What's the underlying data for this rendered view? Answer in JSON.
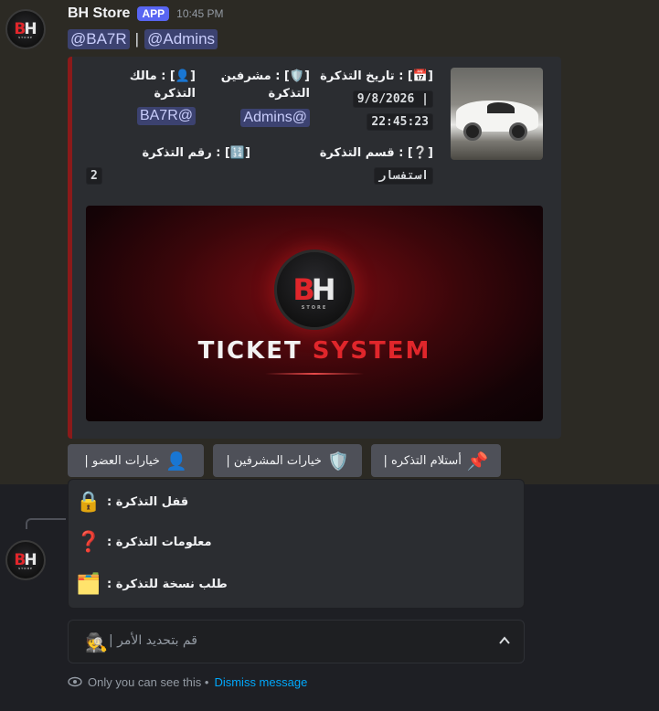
{
  "message": {
    "bot_name": "BH Store",
    "app_badge": "APP",
    "time": "10:45 PM",
    "mention_user": "@BA7R",
    "separator": "|",
    "mention_role": "@Admins"
  },
  "avatar": {
    "letter_b": "B",
    "letter_h": "H",
    "sub": "STORE"
  },
  "embed": {
    "accent_color": "#8b1a1a",
    "fields": {
      "date": {
        "name": "[📅] : تاريخ التذكرة",
        "value_line1": "9/8/2026 |",
        "value_line2": "22:45:23"
      },
      "supervisors": {
        "name": "[🛡️] : مشرفين التذكرة",
        "value": "@Admins"
      },
      "owner": {
        "name": "[👤] : مالك التذكرة",
        "value": "@BA7R"
      },
      "category": {
        "name": "[❔] : قسم التذكرة",
        "value": "استفسار"
      },
      "number": {
        "name": "[🔢] : رقم التذكرة",
        "value": "2"
      }
    },
    "image": {
      "title_part1": "TICKET",
      "title_part2": "SYSTEM",
      "logo_b": "B",
      "logo_h": "H",
      "logo_sub": "STORE"
    }
  },
  "buttons": [
    {
      "label": "أستلام التذكره |",
      "icon": "📌"
    },
    {
      "label": "خيارات المشرفين |",
      "icon": "🛡️"
    },
    {
      "label": "خيارات العضو |",
      "icon": "👤"
    }
  ],
  "dropdown": {
    "items": [
      {
        "label": "قفل التذكرة :",
        "icon": "🔒"
      },
      {
        "label": "معلومات التذكرة :",
        "icon": "❓"
      },
      {
        "label": "طلب نسخة للتذكرة :",
        "icon": "🗂️"
      }
    ]
  },
  "select": {
    "icon": "🕵️",
    "placeholder": "قم بتحديد الأمر |"
  },
  "ephemeral": {
    "text": "Only you can see this •",
    "dismiss": "Dismiss message"
  }
}
